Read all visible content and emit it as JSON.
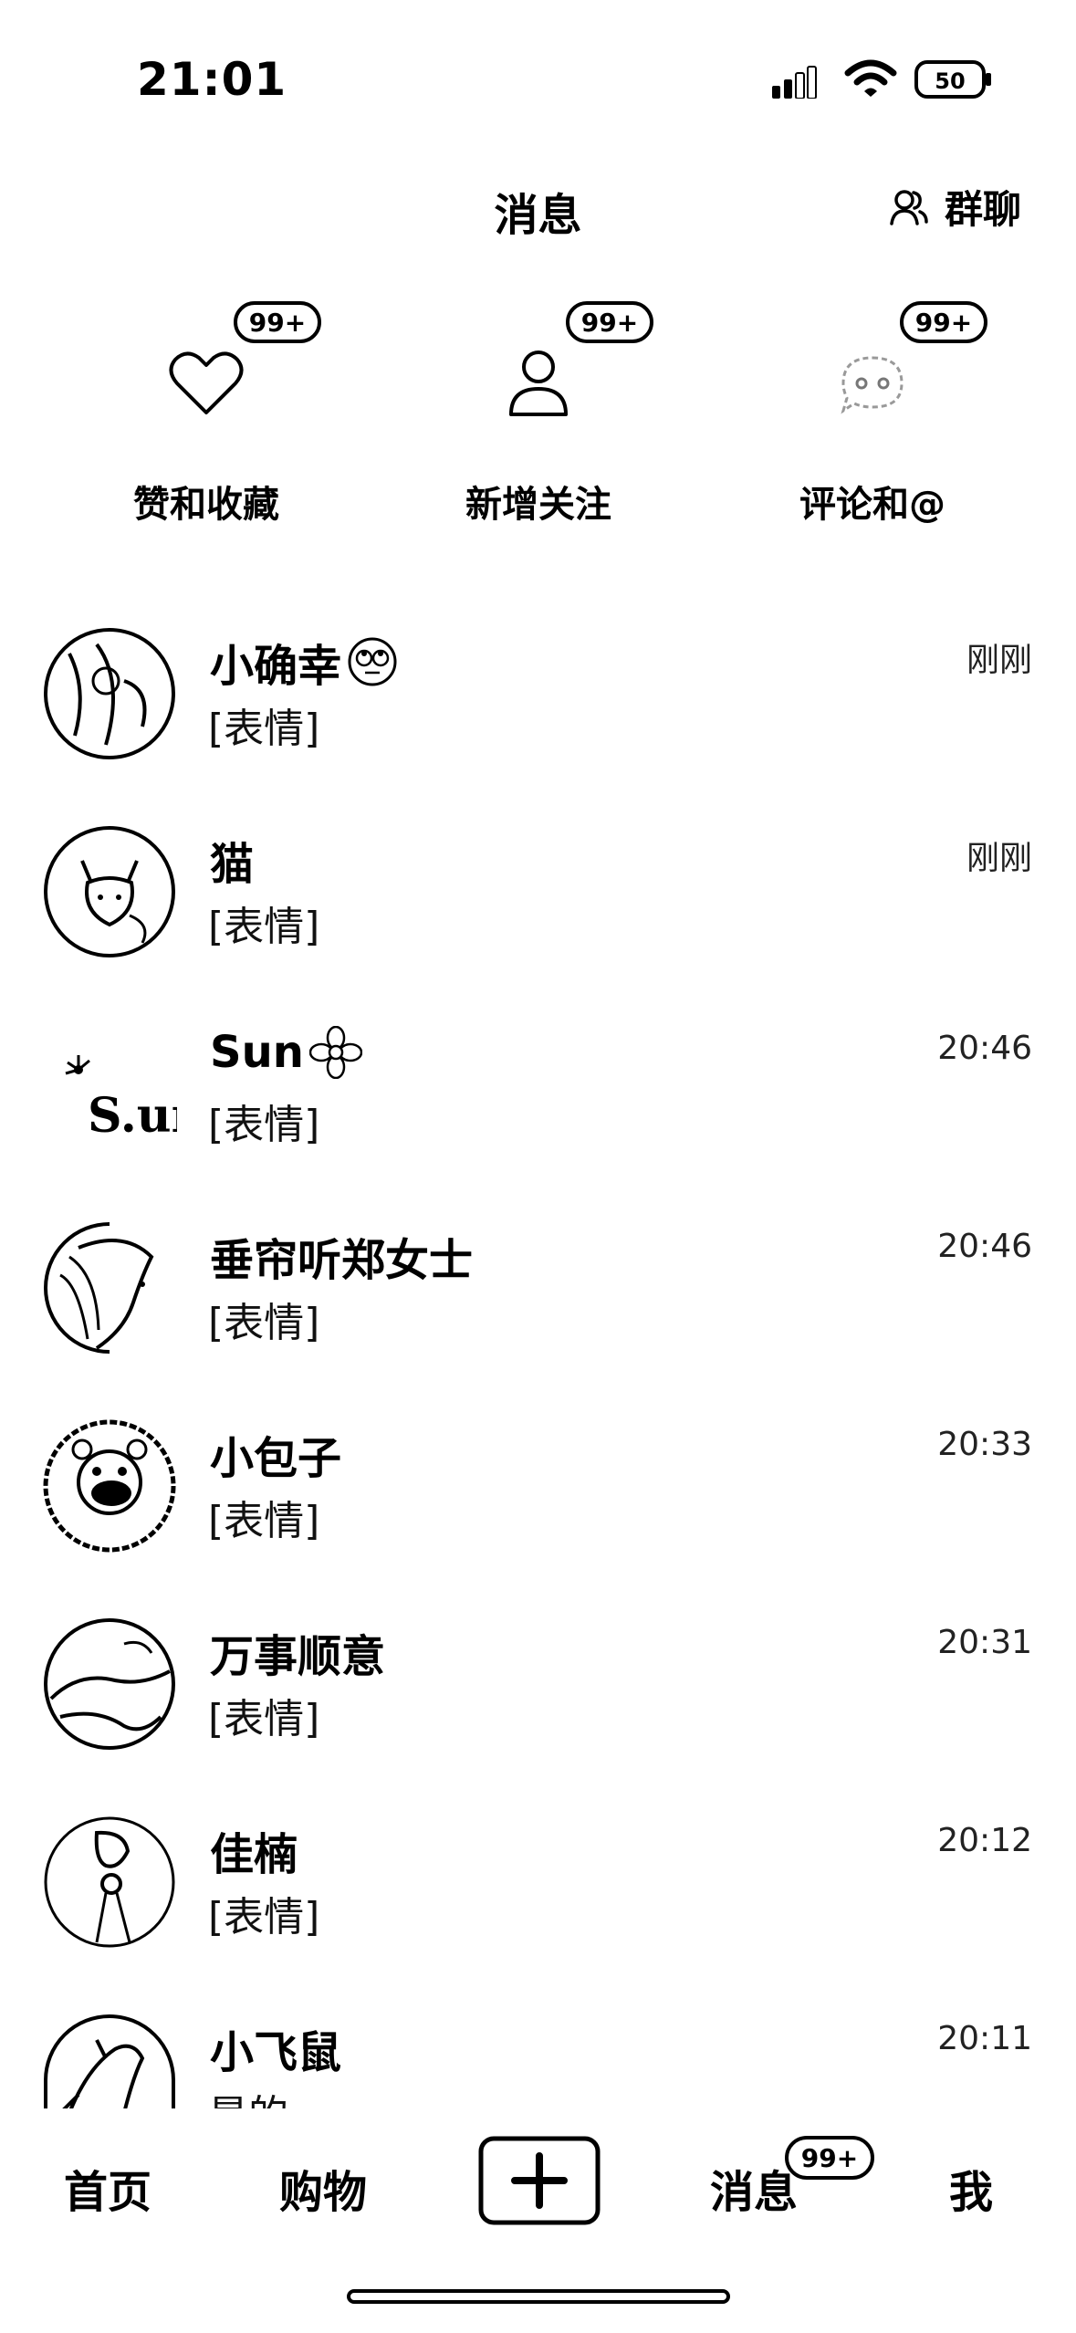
{
  "status_bar": {
    "time": "21:01",
    "battery": "50"
  },
  "header": {
    "title": "消息",
    "group_chat": "群聊"
  },
  "quick_actions": [
    {
      "label": "赞和收藏",
      "badge": "99+",
      "icon": "heart-icon"
    },
    {
      "label": "新增关注",
      "badge": "99+",
      "icon": "person-icon"
    },
    {
      "label": "评论和@",
      "badge": "99+",
      "icon": "chat-bubble-icon"
    }
  ],
  "chats": [
    {
      "name": "小确幸",
      "emoji": "🙄",
      "preview": "[表情]",
      "time": "刚刚"
    },
    {
      "name": "猫",
      "preview": "[表情]",
      "time": "刚刚"
    },
    {
      "name": "Sun",
      "emoji": "✿",
      "preview": "[表情]",
      "time": "20:46"
    },
    {
      "name": "垂帘听郑女士",
      "preview": "[表情]",
      "time": "20:46"
    },
    {
      "name": "小包子",
      "preview": "[表情]",
      "time": "20:33"
    },
    {
      "name": "万事顺意",
      "preview": "[表情]",
      "time": "20:31"
    },
    {
      "name": "佳楠",
      "preview": "[表情]",
      "time": "20:12"
    },
    {
      "name": "小飞鼠",
      "preview": "是的",
      "time": "20:11"
    }
  ],
  "tabbar": {
    "home": "首页",
    "shop": "购物",
    "messages": "消息",
    "messages_badge": "99+",
    "me": "我"
  },
  "avatar_avatar_text": "S.un"
}
